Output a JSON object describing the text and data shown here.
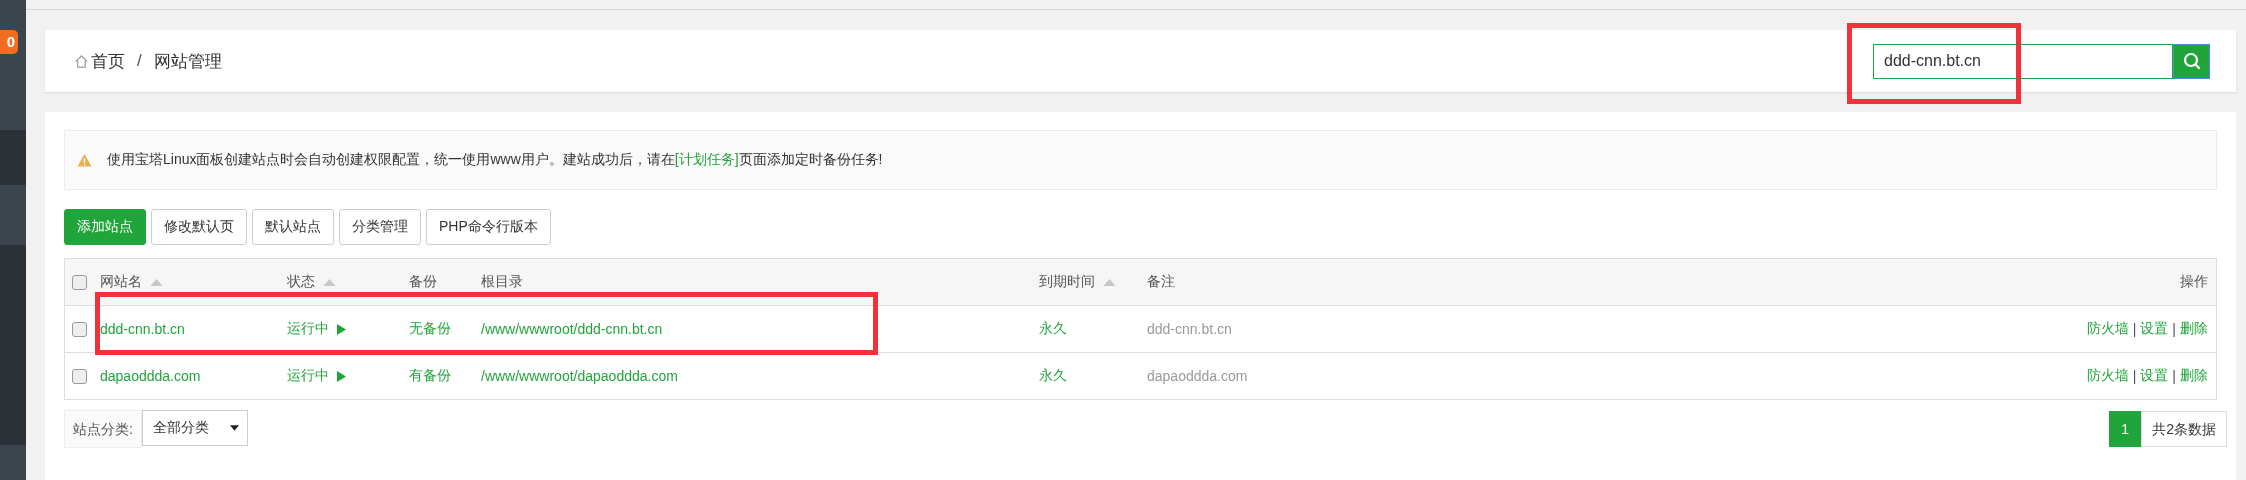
{
  "sidebar": {
    "badge": "0"
  },
  "breadcrumb": {
    "items": [
      "首页",
      "网站管理"
    ],
    "separator": "/"
  },
  "search": {
    "value": "ddd-cnn.bt.cn"
  },
  "notice": {
    "text": "使用宝塔Linux面板创建站点时会自动创建权限配置，统一使用www用户。建站成功后，请在",
    "link": "[计划任务]",
    "after": "页面添加定时备份任务!"
  },
  "toolbar": [
    {
      "label": "添加站点",
      "primary": true
    },
    {
      "label": "修改默认页",
      "primary": false
    },
    {
      "label": "默认站点",
      "primary": false
    },
    {
      "label": "分类管理",
      "primary": false
    },
    {
      "label": "PHP命令行版本",
      "primary": false
    }
  ],
  "table": {
    "all_checked": false,
    "columns": [
      {
        "label": "网站名",
        "sortable": true
      },
      {
        "label": "状态",
        "sortable": true
      },
      {
        "label": "备份",
        "sortable": false
      },
      {
        "label": "根目录",
        "sortable": false
      },
      {
        "label": "到期时间",
        "sortable": true
      },
      {
        "label": "备注",
        "sortable": false
      },
      {
        "label": "操作",
        "sortable": false
      }
    ],
    "rows": [
      {
        "checked": false,
        "name": "ddd-cnn.bt.cn",
        "status": "运行中",
        "backup": "无备份",
        "root": "/www/wwwroot/ddd-cnn.bt.cn",
        "expiry": "永久",
        "remark": "ddd-cnn.bt.cn",
        "actions": [
          "防火墙",
          "设置",
          "删除"
        ],
        "separator": "|"
      },
      {
        "checked": false,
        "name": "dapaoddda.com",
        "status": "运行中",
        "backup": "有备份",
        "root": "/www/wwwroot/dapaoddda.com",
        "expiry": "永久",
        "remark": "dapaoddda.com",
        "actions": [
          "防火墙",
          "设置",
          "删除"
        ],
        "separator": "|"
      }
    ]
  },
  "footer": {
    "category_label": "站点分类:",
    "category_value": "全部分类",
    "pages": [
      {
        "label": "1",
        "selected": true
      }
    ],
    "total": "共2条数据"
  }
}
